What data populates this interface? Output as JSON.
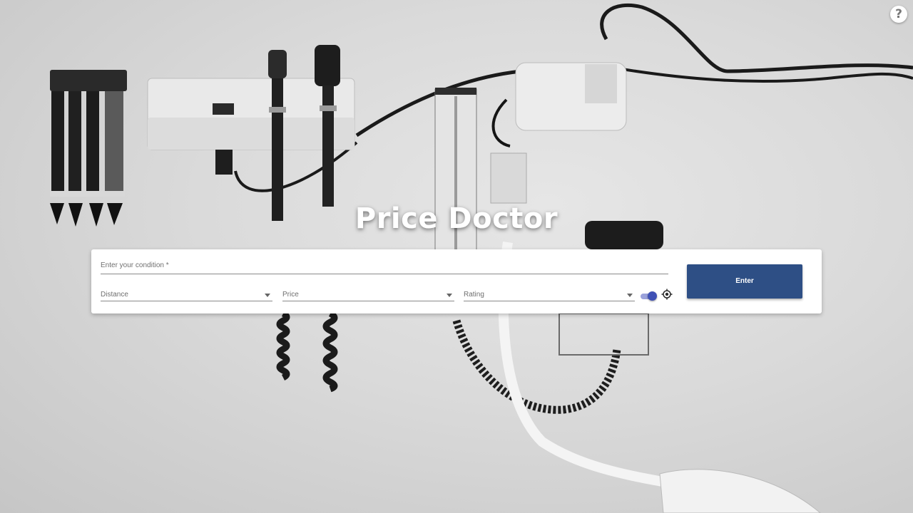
{
  "app": {
    "title": "Price Doctor",
    "help_icon": "question-mark-circle-icon",
    "help_label": "?"
  },
  "search_form": {
    "condition": {
      "placeholder": "Enter your condition *",
      "value": ""
    },
    "filters": [
      {
        "label": "Distance",
        "icon": "chevron-down-icon"
      },
      {
        "label": "Price",
        "icon": "chevron-down-icon"
      },
      {
        "label": "Rating",
        "icon": "chevron-down-icon"
      }
    ],
    "location_toggle": {
      "on": true,
      "color": "#3f51b5"
    },
    "locate_icon": "gps-crosshair-icon",
    "submit_label": "Enter"
  },
  "colors": {
    "button": "#2e4f85",
    "toggle": "#3f51b5",
    "card": "#ffffff",
    "title": "#ffffff"
  }
}
